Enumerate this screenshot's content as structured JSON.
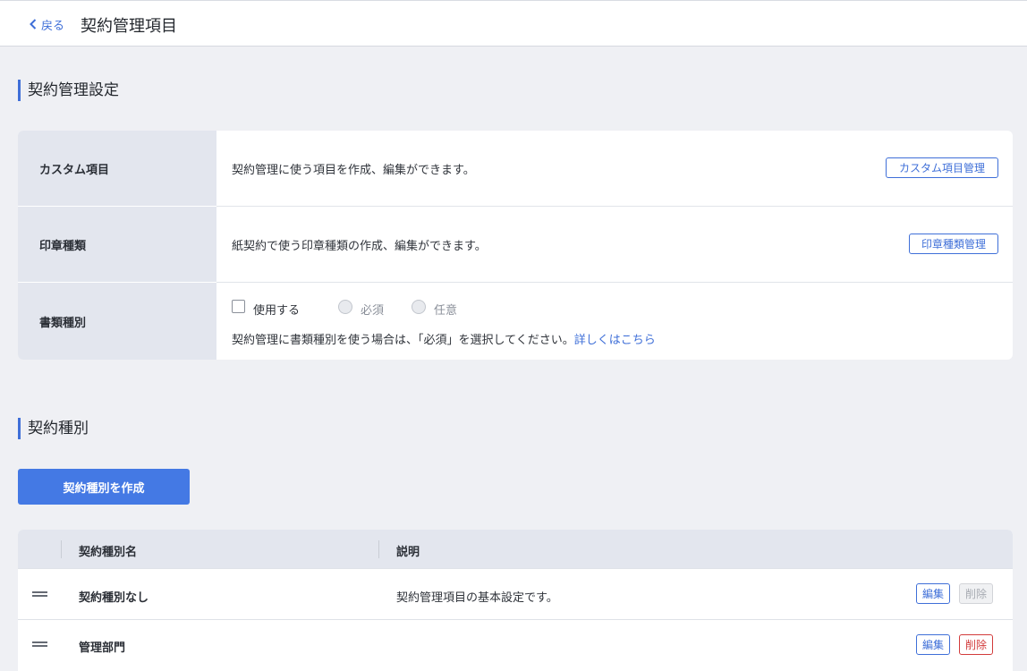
{
  "header": {
    "back_label": "戻る",
    "title": "契約管理項目"
  },
  "settings_section": {
    "title": "契約管理設定",
    "custom_fields": {
      "label": "カスタム項目",
      "description": "契約管理に使う項目を作成、編集ができます。",
      "button": "カスタム項目管理"
    },
    "seal_types": {
      "label": "印章種類",
      "description": "紙契約で使う印章種類の作成、編集ができます。",
      "button": "印章種類管理"
    },
    "document_types": {
      "label": "書類種別",
      "use_checkbox_label": "使用する",
      "use_checked": false,
      "radio_required": "必須",
      "radio_optional": "任意",
      "note": "契約管理に書類種別を使う場合は、「必須」を選択してください。",
      "link": "詳しくはこちら"
    }
  },
  "contract_types_section": {
    "title": "契約種別",
    "create_button": "契約種別を作成",
    "columns": {
      "name": "契約種別名",
      "description": "説明"
    },
    "rows": [
      {
        "name": "契約種別なし",
        "description": "契約管理項目の基本設定です。",
        "edit": "編集",
        "delete": "削除",
        "delete_enabled": false
      },
      {
        "name": "管理部門",
        "description": "",
        "edit": "編集",
        "delete": "削除",
        "delete_enabled": true
      }
    ]
  },
  "colors": {
    "accent": "#3f6fd8",
    "primary_button": "#4479e4",
    "danger": "#d23b3b",
    "background": "#eff0f4"
  },
  "icons": {
    "back": "chevron-left-icon",
    "drag": "drag-handle-icon"
  }
}
